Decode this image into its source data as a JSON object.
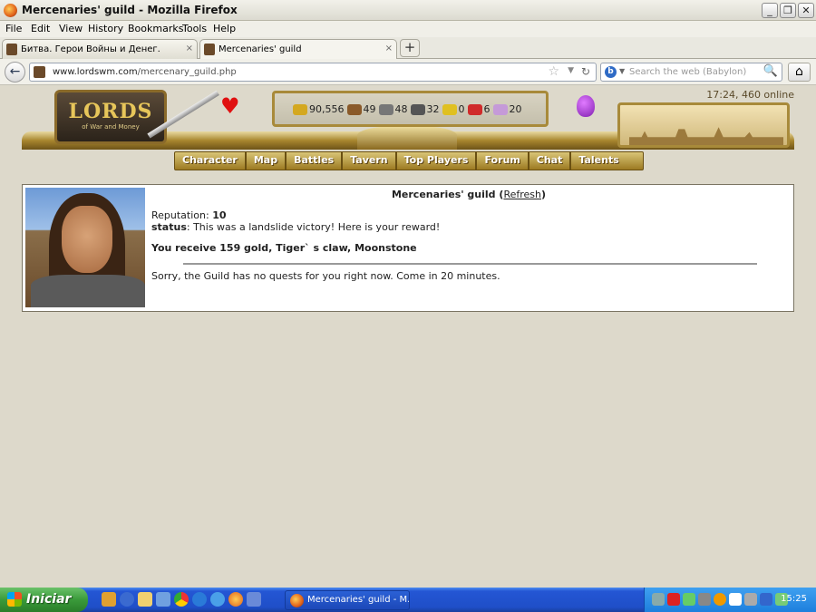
{
  "window": {
    "title": "Mercenaries' guild - Mozilla Firefox",
    "controls": {
      "minimize": "_",
      "maximize": "❐",
      "close": "✕"
    }
  },
  "menu": [
    "File",
    "Edit",
    "View",
    "History",
    "Bookmarks",
    "Tools",
    "Help"
  ],
  "tabs": [
    {
      "label": "Битва. Герои Войны и Денег.",
      "close": "×",
      "active": false
    },
    {
      "label": "Mercenaries' guild",
      "close": "×",
      "active": true
    }
  ],
  "new_tab_label": "+",
  "nav": {
    "back": "←",
    "url_domain": "www.lordswm.com",
    "url_path": "/mercenary_guild.php",
    "search_placeholder": "Search the web (Babylon)",
    "home": "⌂"
  },
  "status": {
    "time_online": "17:24, 460 online"
  },
  "logo": {
    "main": "LORDS",
    "sub": "of War and Money"
  },
  "resources": [
    {
      "icon": "gold-icon",
      "value": "90,556",
      "color": "#d4a820"
    },
    {
      "icon": "wood-icon",
      "value": "49",
      "color": "#8a5a2a"
    },
    {
      "icon": "ore-icon",
      "value": "48",
      "color": "#777777"
    },
    {
      "icon": "mercury-icon",
      "value": "32",
      "color": "#555555"
    },
    {
      "icon": "sulfur-icon",
      "value": "0",
      "color": "#e0c020"
    },
    {
      "icon": "crystal-icon",
      "value": "6",
      "color": "#d02a2a"
    },
    {
      "icon": "gems-icon",
      "value": "20",
      "color": "#c59ad8"
    }
  ],
  "game_nav": [
    "Character",
    "Map",
    "Battles",
    "Tavern",
    "Top Players",
    "Forum",
    "Chat",
    "Talents"
  ],
  "panel": {
    "title": "Mercenaries' guild",
    "refresh_open": "(",
    "refresh": "Refresh",
    "refresh_close": ")",
    "reputation_label": "Reputation:",
    "reputation_value": "10",
    "status_label": "status",
    "status_text": ": This was a landslide victory! Here is your reward!",
    "reward": "You receive 159 gold, Tiger` s claw, Moonstone",
    "no_quests": "Sorry, the Guild has no quests for you right now. Come in 20 minutes."
  },
  "taskbar": {
    "start": "Iniciar",
    "task": "Mercenaries' guild - M...",
    "clock": "15:25"
  }
}
